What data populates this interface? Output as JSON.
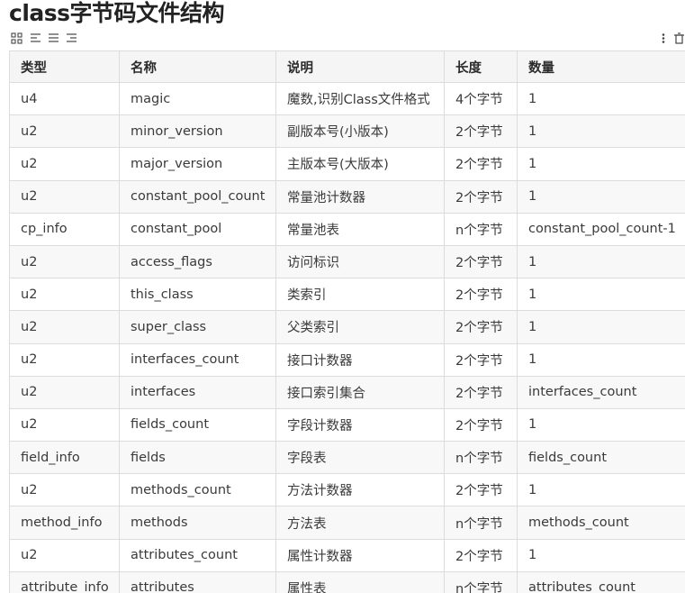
{
  "page": {
    "title": "class字节码文件结构"
  },
  "toolbar": {
    "icons": [
      "table-grid-icon",
      "align-left-icon",
      "align-center-icon",
      "align-right-icon",
      "more-vertical-icon",
      "delete-icon"
    ]
  },
  "table": {
    "headers": [
      "类型",
      "名称",
      "说明",
      "长度",
      "数量"
    ],
    "rows": [
      [
        "u4",
        "magic",
        "魔数,识别Class文件格式",
        "4个字节",
        "1"
      ],
      [
        "u2",
        "minor_version",
        "副版本号(小版本)",
        "2个字节",
        "1"
      ],
      [
        "u2",
        "major_version",
        "主版本号(大版本)",
        "2个字节",
        "1"
      ],
      [
        "u2",
        "constant_pool_count",
        "常量池计数器",
        "2个字节",
        "1"
      ],
      [
        "cp_info",
        "constant_pool",
        "常量池表",
        "n个字节",
        "constant_pool_count-1"
      ],
      [
        "u2",
        "access_flags",
        "访问标识",
        "2个字节",
        "1"
      ],
      [
        "u2",
        "this_class",
        "类索引",
        "2个字节",
        "1"
      ],
      [
        "u2",
        "super_class",
        "父类索引",
        "2个字节",
        "1"
      ],
      [
        "u2",
        "interfaces_count",
        "接口计数器",
        "2个字节",
        "1"
      ],
      [
        "u2",
        "interfaces",
        "接口索引集合",
        "2个字节",
        "interfaces_count"
      ],
      [
        "u2",
        "fields_count",
        "字段计数器",
        "2个字节",
        "1"
      ],
      [
        "field_info",
        "fields",
        "字段表",
        "n个字节",
        "fields_count"
      ],
      [
        "u2",
        "methods_count",
        "方法计数器",
        "2个字节",
        "1"
      ],
      [
        "method_info",
        "methods",
        "方法表",
        "n个字节",
        "methods_count"
      ],
      [
        "u2",
        "attributes_count",
        "属性计数器",
        "2个字节",
        "1"
      ],
      [
        "attribute_info",
        "attributes",
        "属性表",
        "n个字节",
        "attributes_count"
      ]
    ]
  }
}
